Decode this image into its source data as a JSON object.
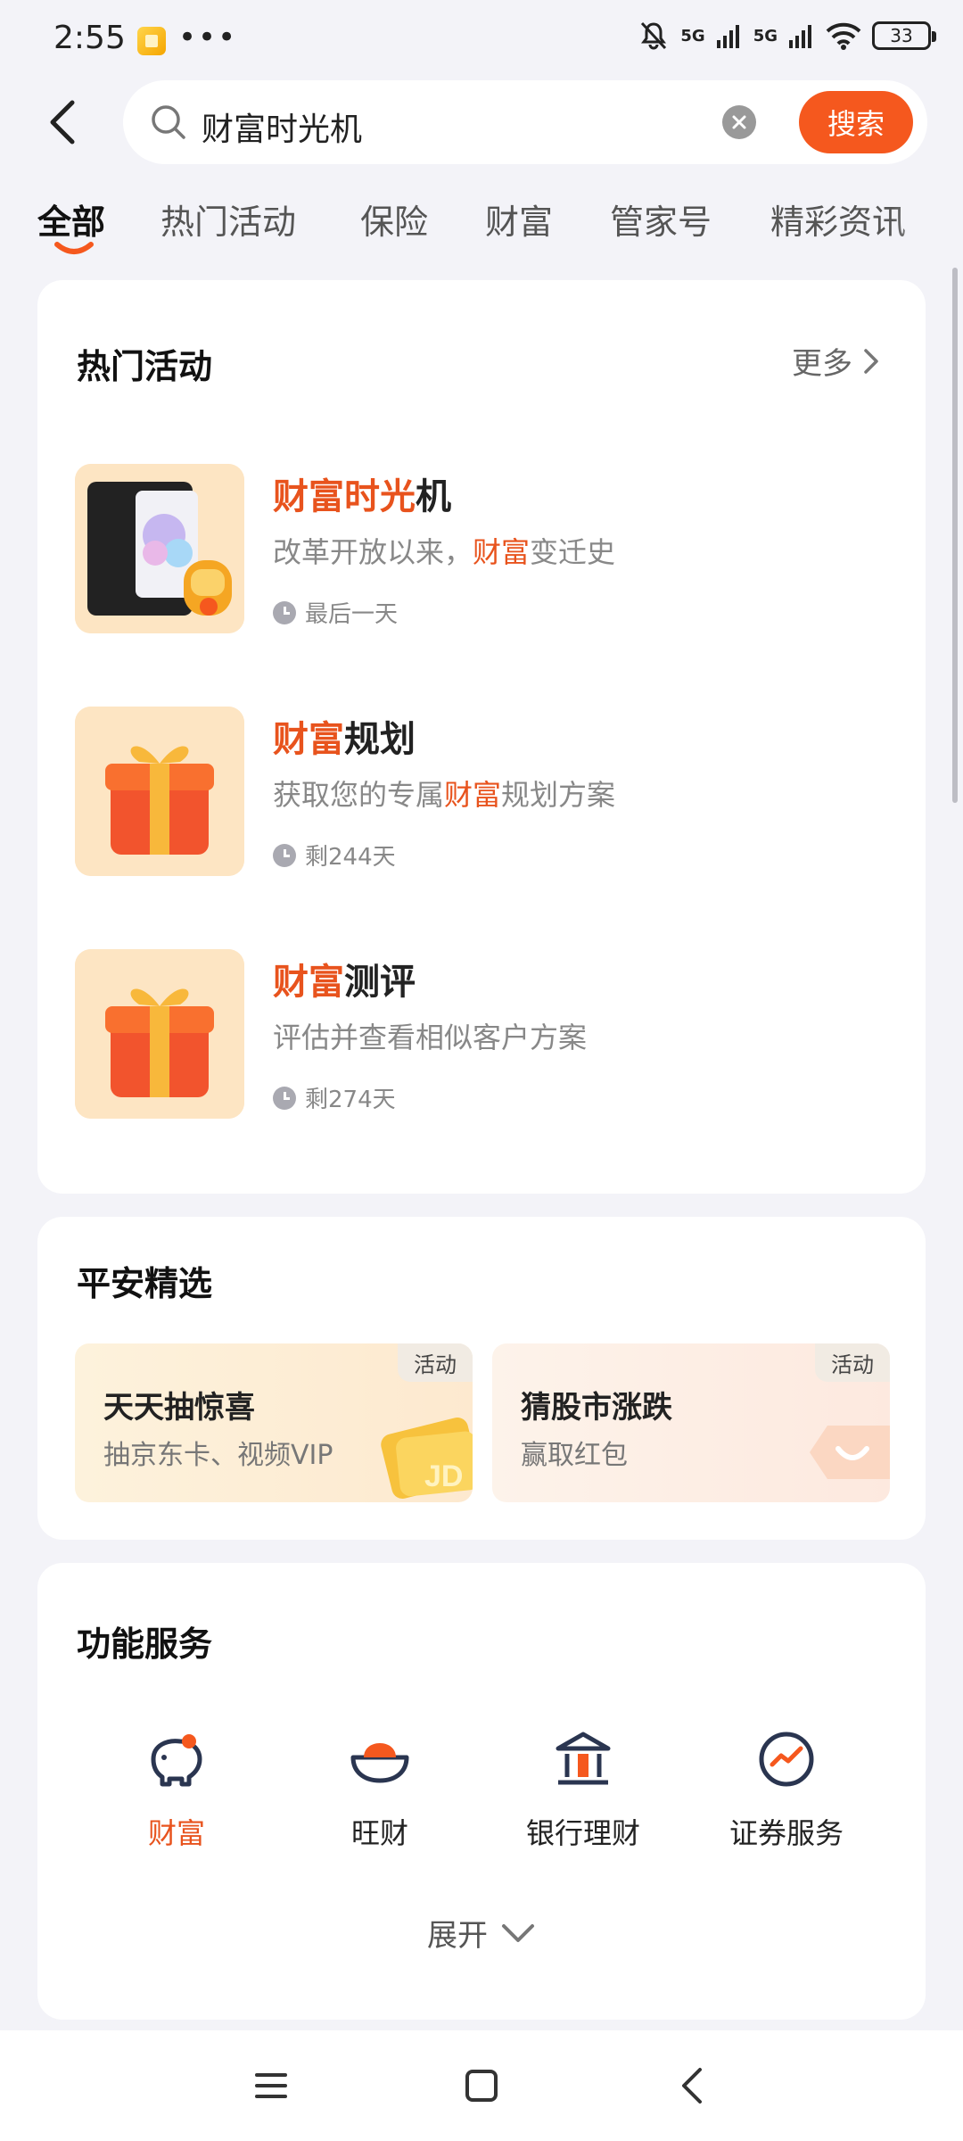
{
  "status_bar": {
    "time": "2:55",
    "dots": "•••",
    "signal1": "5G",
    "signal2": "5G",
    "battery": "33"
  },
  "search": {
    "value": "财富时光机",
    "button_label": "搜索"
  },
  "tabs": [
    {
      "label": "全部"
    },
    {
      "label": "热门活动"
    },
    {
      "label": "保险"
    },
    {
      "label": "财富"
    },
    {
      "label": "管家号"
    },
    {
      "label": "精彩资讯"
    }
  ],
  "hot_activities": {
    "title": "热门活动",
    "more_label": "更多",
    "items": [
      {
        "title_hl": "财富时光",
        "title_rest": "机",
        "desc_pre": "改革开放以来，",
        "desc_hl": "财富",
        "desc_post": "变迁史",
        "time": "最后一天"
      },
      {
        "title_hl": "财富",
        "title_rest": "规划",
        "desc_pre": "获取您的专属",
        "desc_hl": "财富",
        "desc_post": "规划方案",
        "time": "剩244天"
      },
      {
        "title_hl": "财富",
        "title_rest": "测评",
        "desc_pre": "评估并查看相似客户方案",
        "desc_hl": "",
        "desc_post": "",
        "time": "剩274天"
      }
    ]
  },
  "pingan_picks": {
    "title": "平安精选",
    "items": [
      {
        "tag": "活动",
        "title": "天天抽惊喜",
        "subtitle": "抽京东卡、视频VIP"
      },
      {
        "tag": "活动",
        "title": "猜股市涨跌",
        "subtitle": "赢取红包"
      }
    ]
  },
  "services": {
    "title": "功能服务",
    "items": [
      {
        "label": "财富",
        "icon": "piggy-bank-icon"
      },
      {
        "label": "旺财",
        "icon": "gold-ingot-icon"
      },
      {
        "label": "银行理财",
        "icon": "bank-icon"
      },
      {
        "label": "证券服务",
        "icon": "stock-trend-icon"
      }
    ],
    "expand_label": "展开"
  },
  "colors": {
    "accent": "#f5581e",
    "highlight": "#e8531d",
    "background": "#f3f3f8"
  }
}
